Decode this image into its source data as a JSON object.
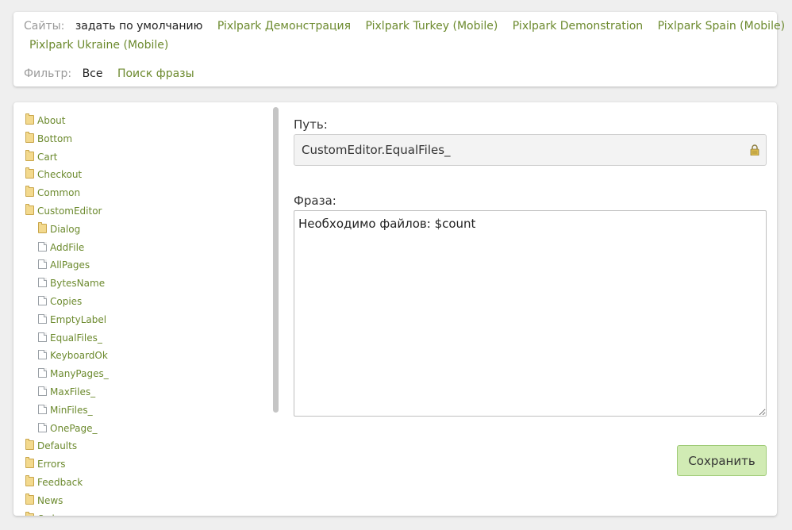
{
  "sites": {
    "label": "Сайты:",
    "current": "задать по умолчанию",
    "links": [
      "Pixlpark Демонстрация",
      "Pixlpark Turkey (Mobile)",
      "Pixlpark Demonstration",
      "Pixlpark Spain (Mobile)",
      "Pixlpark Ukraine (Mobile)"
    ]
  },
  "filter": {
    "label": "Фильтр:",
    "current": "Все",
    "link": "Поиск фразы"
  },
  "tree": {
    "items": [
      {
        "label": "About",
        "type": "folder",
        "level": 0
      },
      {
        "label": "Bottom",
        "type": "folder",
        "level": 0
      },
      {
        "label": "Cart",
        "type": "folder",
        "level": 0
      },
      {
        "label": "Checkout",
        "type": "folder",
        "level": 0
      },
      {
        "label": "Common",
        "type": "folder",
        "level": 0
      },
      {
        "label": "CustomEditor",
        "type": "folder",
        "level": 0
      },
      {
        "label": "Dialog",
        "type": "folder",
        "level": 1
      },
      {
        "label": "AddFile",
        "type": "file",
        "level": 1
      },
      {
        "label": "AllPages",
        "type": "file",
        "level": 1
      },
      {
        "label": "BytesName",
        "type": "file",
        "level": 1
      },
      {
        "label": "Copies",
        "type": "file",
        "level": 1
      },
      {
        "label": "EmptyLabel",
        "type": "file",
        "level": 1
      },
      {
        "label": "EqualFiles_",
        "type": "file",
        "level": 1
      },
      {
        "label": "KeyboardOk",
        "type": "file",
        "level": 1
      },
      {
        "label": "ManyPages_",
        "type": "file",
        "level": 1
      },
      {
        "label": "MaxFiles_",
        "type": "file",
        "level": 1
      },
      {
        "label": "MinFiles_",
        "type": "file",
        "level": 1
      },
      {
        "label": "OnePage_",
        "type": "file",
        "level": 1
      },
      {
        "label": "Defaults",
        "type": "folder",
        "level": 0
      },
      {
        "label": "Errors",
        "type": "folder",
        "level": 0
      },
      {
        "label": "Feedback",
        "type": "folder",
        "level": 0
      },
      {
        "label": "News",
        "type": "folder",
        "level": 0
      },
      {
        "label": "Orders",
        "type": "folder",
        "level": 0
      }
    ]
  },
  "editor": {
    "path_label": "Путь:",
    "path_value": "CustomEditor.EqualFiles_",
    "path_icon": "lock-icon",
    "phrase_label": "Фраза:",
    "phrase_value": "Необходимо файлов: $count",
    "save_label": "Сохранить"
  },
  "colors": {
    "link": "#6c8a2e",
    "save_bg": "#d1ebb4",
    "folder": "#f3d98e"
  }
}
